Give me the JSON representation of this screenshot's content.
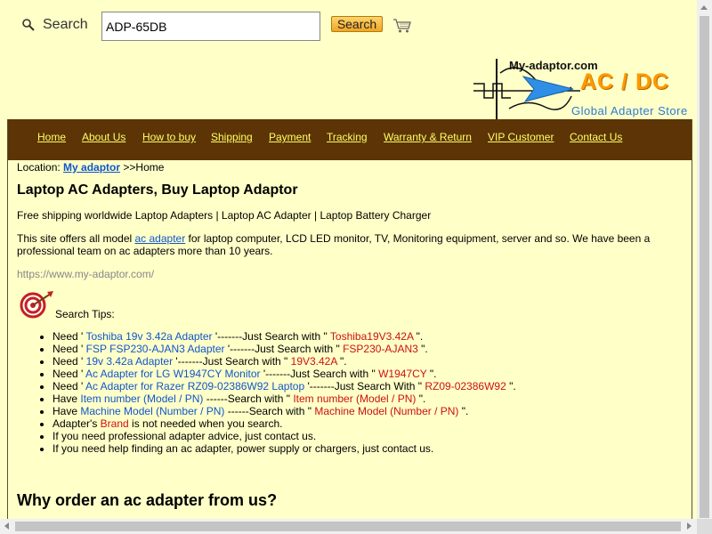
{
  "search": {
    "label": "Search",
    "value": "ADP-65DB",
    "button_label": "Search"
  },
  "logo": {
    "url_text": "My-adaptor.com",
    "acdc_text": "AC / DC",
    "subtitle": "Global Adapter Store"
  },
  "nav": {
    "items": [
      "Home",
      "About Us",
      "How to buy",
      "Shipping",
      "Payment",
      "Tracking",
      "Warranty & Return",
      "VIP Customer",
      "Contact Us"
    ]
  },
  "location": {
    "prefix": "Location: ",
    "link": "My adaptor",
    "suffix": " >>Home"
  },
  "main": {
    "title": "Laptop AC Adapters, Buy Laptop Adaptor",
    "intro": "Free shipping worldwide Laptop Adapters | Laptop AC Adapter | Laptop Battery Charger",
    "para_before": "This site offers all model ",
    "para_link": "ac adapter",
    "para_after": " for laptop computer, LCD LED monitor, TV, Monitoring equipment, server and so. We have been a professional team on ac adapters more than 10 years.",
    "url": "https://www.my-adaptor.com/",
    "tips_label": "Search Tips:",
    "why_title": "Why order an ac adapter from us?"
  },
  "tips": [
    {
      "a": "Need ' ",
      "b": "Toshiba 19v 3.42a Adapter",
      "c": " '-------Just Search with \" ",
      "d": "Toshiba19V3.42A",
      "e": " \"."
    },
    {
      "a": "Need ' ",
      "b": "FSP FSP230-AJAN3 Adapter",
      "c": " '-------Just Search with \" ",
      "d": "FSP230-AJAN3",
      "e": " \"."
    },
    {
      "a": "Need ' ",
      "b": "19v 3.42a Adapter",
      "c": " '-------Just Search with \" ",
      "d": "19V3.42A",
      "e": " \"."
    },
    {
      "a": "Need ' ",
      "b": "Ac Adapter for LG W1947CY Monitor",
      "c": " '-------Just Search with \" ",
      "d": "W1947CY",
      "e": " \"."
    },
    {
      "a": "Need ' ",
      "b": "Ac Adapter for Razer RZ09-02386W92 Laptop",
      "c": " '-------Just Search With \" ",
      "d": "RZ09-02386W92",
      "e": " \"."
    },
    {
      "a": "Have ",
      "b": "Item number (Model / PN)",
      "c": " ------Search with \" ",
      "d": "Item number (Model / PN)",
      "e": " \"."
    },
    {
      "a": "Have ",
      "b": "Machine Model (Number / PN)",
      "c": " ------Search with \" ",
      "d": "Machine Model (Number / PN)",
      "e": " \"."
    },
    {
      "a": "Adapter's ",
      "b": "",
      "c": "",
      "d": "Brand",
      "e": " is not needed when you search."
    },
    {
      "a": "If you need professional adapter advice, just contact us.",
      "b": "",
      "c": "",
      "d": "",
      "e": ""
    },
    {
      "a": "If you need help finding an ac adapter, power supply or chargers, just contact us.",
      "b": "",
      "c": "",
      "d": "",
      "e": ""
    }
  ],
  "colors": {
    "background": "#ffffc8",
    "nav_bg": "#5c3405",
    "nav_link": "#ffff66",
    "link_blue": "#1155cc",
    "highlight_red": "#cc1111"
  },
  "icons": [
    "magnifier-icon",
    "cart-icon",
    "target-icon"
  ]
}
